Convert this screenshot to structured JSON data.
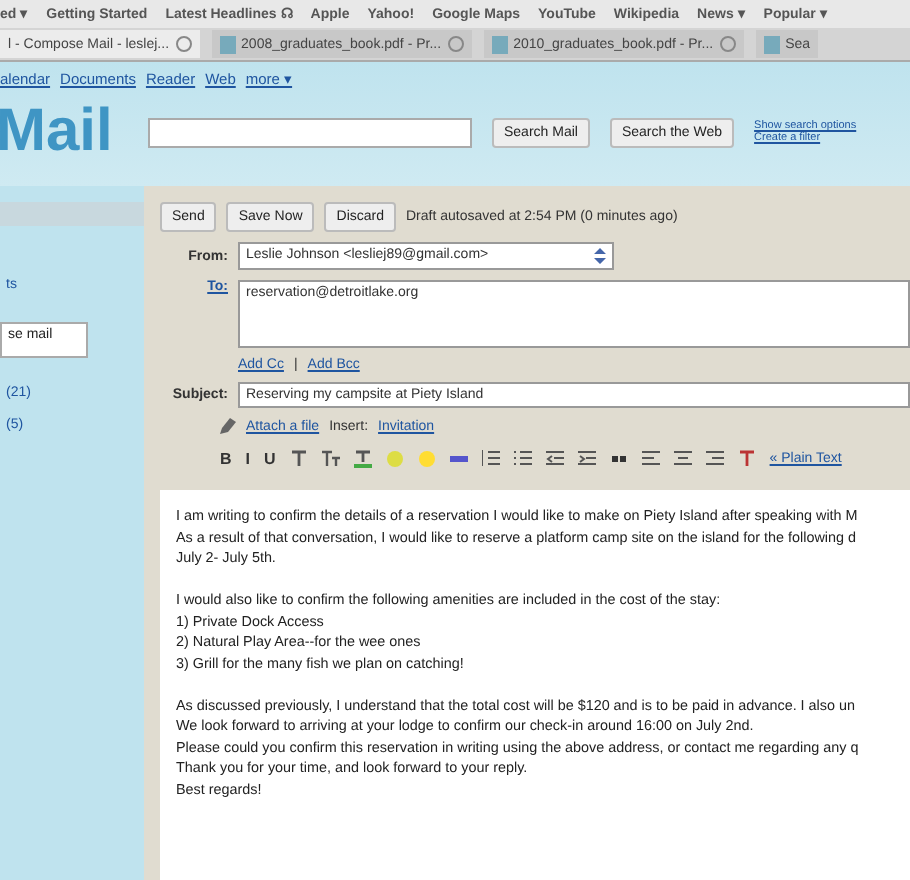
{
  "bookmarks": [
    "ed ▾",
    "Getting Started",
    "Latest Headlines ☊",
    "Apple",
    "Yahoo!",
    "Google Maps",
    "YouTube",
    "Wikipedia",
    "News ▾",
    "Popular ▾"
  ],
  "tabs": [
    {
      "title": "l - Compose Mail - leslej...",
      "selected": true
    },
    {
      "title": "2008_graduates_book.pdf - Pr...",
      "selected": false
    },
    {
      "title": "2010_graduates_book.pdf - Pr...",
      "selected": false
    },
    {
      "title": "Sea",
      "selected": false
    }
  ],
  "top_links": [
    "alendar",
    "Documents",
    "Reader",
    "Web",
    "more ▾"
  ],
  "logo": "Mail",
  "search": {
    "buttons": [
      "Search Mail",
      "Search the Web"
    ],
    "links": [
      "Show search options",
      "Create a filter"
    ]
  },
  "sidebar": {
    "items": [
      "ts",
      "se mail",
      "(21)",
      "(5)"
    ]
  },
  "compose": {
    "buttons": [
      "Send",
      "Save Now",
      "Discard"
    ],
    "status": "Draft autosaved at 2:54 PM (0 minutes ago)",
    "from_label": "From:",
    "from_value": "Leslie Johnson <lesliej89@gmail.com>",
    "to_label": "To:",
    "to_value": "reservation@detroitlake.org",
    "cc_links": [
      "Add Cc",
      "Add Bcc"
    ],
    "cc_separator": "|",
    "subject_label": "Subject:",
    "subject_value": "Reserving my campsite at Piety Island",
    "attach_link": "Attach a file",
    "insert_label": "Insert:",
    "insert_link": "Invitation",
    "format_buttons": [
      "B",
      "I",
      "U"
    ],
    "plain_text_link": "« Plain Text",
    "body": [
      [
        "I am writing to confirm the details of a reservation I would like to make on Piety Island after speaking with M",
        "As a result of that conversation, I would like to reserve a platform camp site on the island for the following d",
        "July 2- July 5th."
      ],
      [
        "I would also like to confirm the following amenities are included in the cost of the stay:",
        "1) Private Dock Access",
        "2) Natural Play Area--for the wee ones",
        "3) Grill for the many fish we plan on catching!"
      ],
      [
        "As discussed previously, I understand that the total cost will be $120 and is to be paid in advance. I also un",
        "We look forward to arriving at your lodge to confirm our check-in around 16:00 on July 2nd.",
        "Please could you confirm this reservation in writing using the above address, or contact me regarding any q",
        "Thank you for your time, and look forward to your reply.",
        "Best regards!"
      ]
    ]
  }
}
